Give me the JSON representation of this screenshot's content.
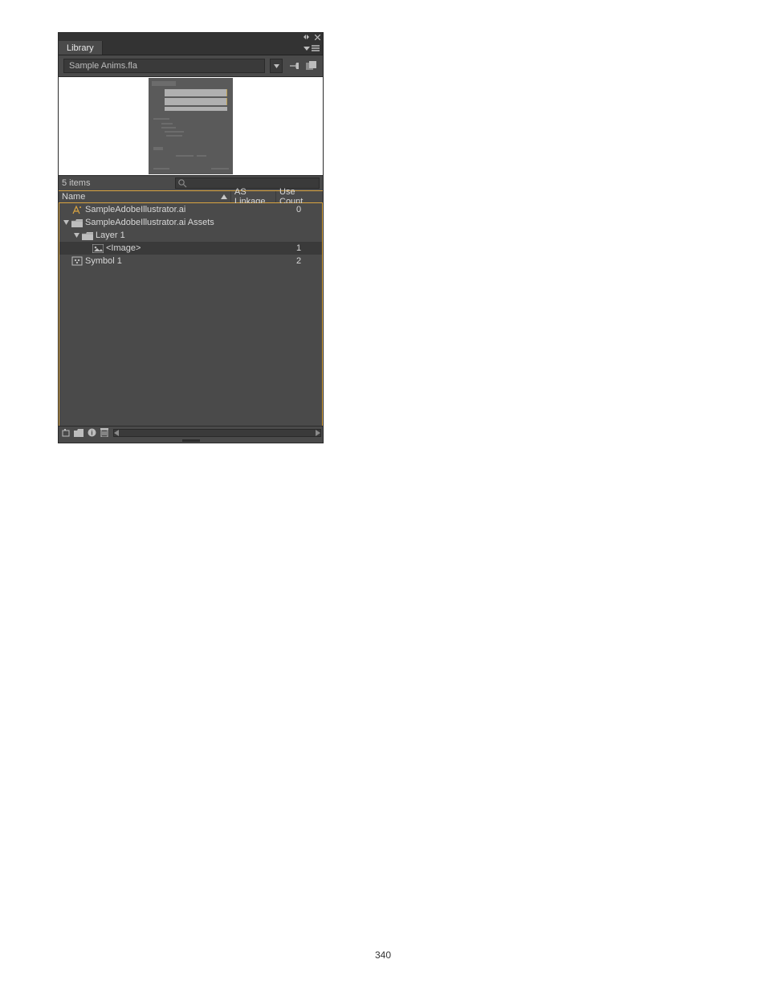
{
  "panel": {
    "tab": "Library",
    "document": "Sample Anims.fla",
    "item_count_label": "5 items",
    "columns": {
      "name": "Name",
      "linkage": "AS Linkage",
      "use": "Use Count"
    },
    "rows": [
      {
        "indent": 0,
        "disclosure": "",
        "icon": "ai-file",
        "name": "SampleAdobeIllustrator.ai",
        "linkage": "",
        "use": "0",
        "selected": false
      },
      {
        "indent": 0,
        "disclosure": "down",
        "icon": "folder",
        "name": "SampleAdobeIllustrator.ai Assets",
        "linkage": "",
        "use": "",
        "selected": false
      },
      {
        "indent": 1,
        "disclosure": "down",
        "icon": "folder",
        "name": "Layer 1",
        "linkage": "",
        "use": "",
        "selected": false
      },
      {
        "indent": 2,
        "disclosure": "",
        "icon": "image",
        "name": "<Image>",
        "linkage": "",
        "use": "1",
        "selected": true
      },
      {
        "indent": 0,
        "disclosure": "",
        "icon": "movieclip",
        "name": "Symbol 1",
        "linkage": "",
        "use": "2",
        "selected": false
      }
    ]
  },
  "page_number": "340"
}
